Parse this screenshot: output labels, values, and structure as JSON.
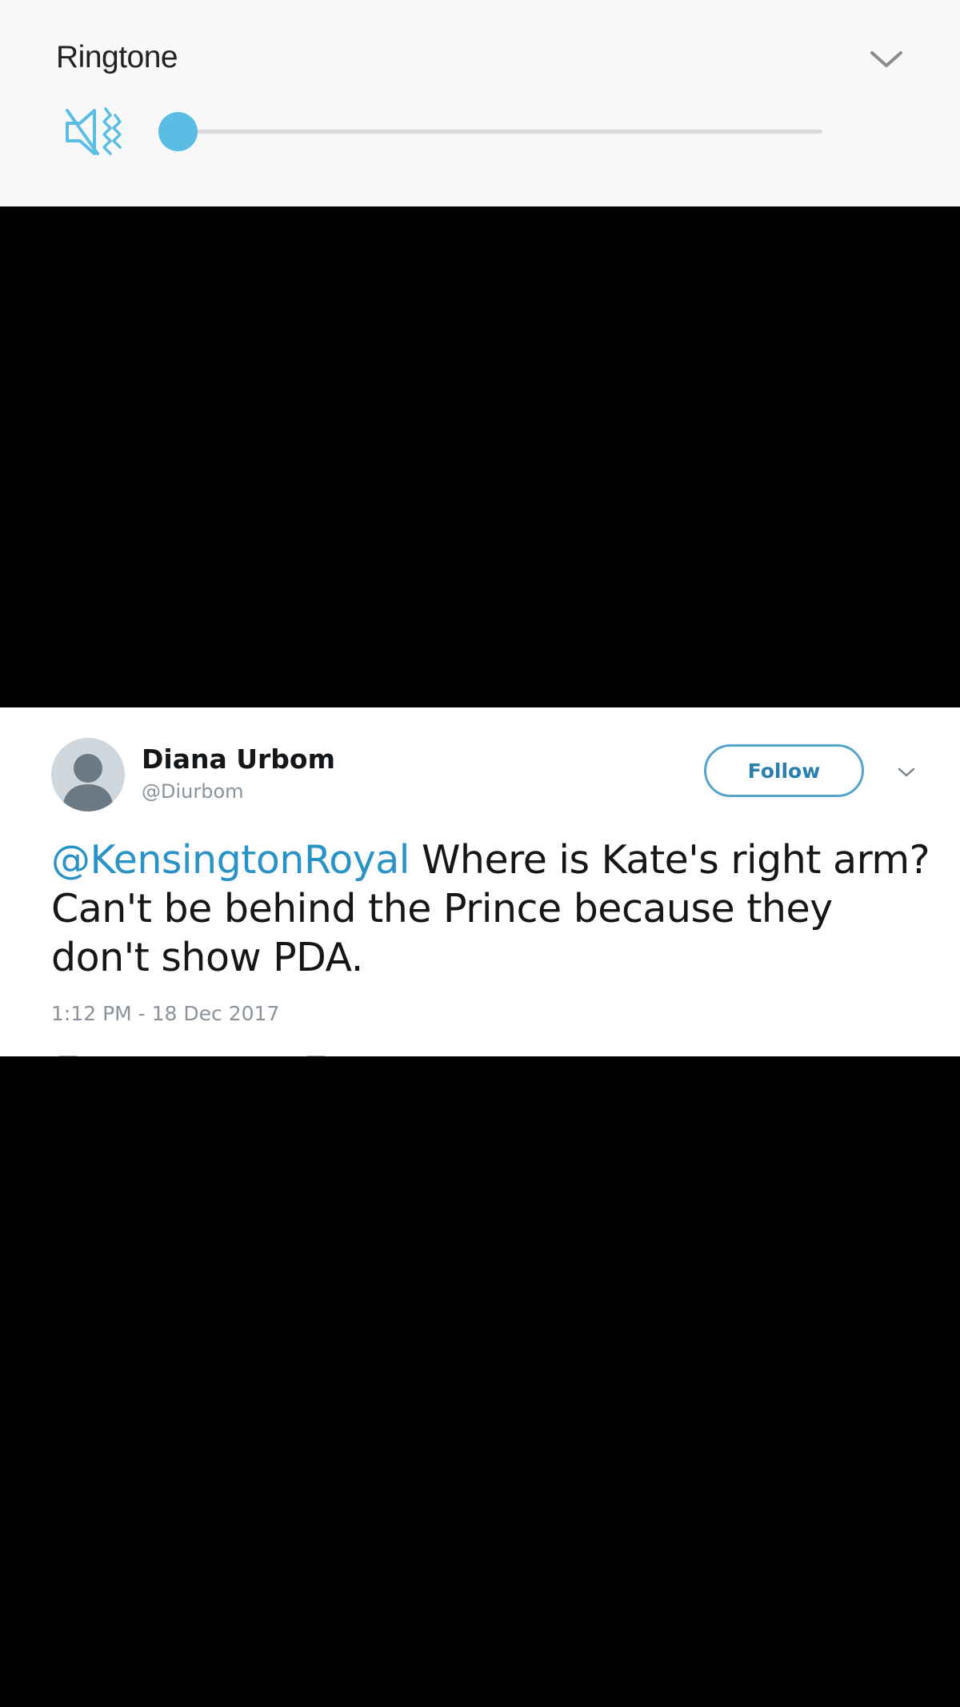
{
  "volume_panel": {
    "title": "Ringtone",
    "expand_icon": "chevron-down-icon",
    "mute_icon": "speaker-vibrate-icon",
    "level": 0,
    "accent_color": "#5bbde4"
  },
  "tweet": {
    "name": "Diana Urbom",
    "handle": "@Diurbom",
    "follow_label": "Follow",
    "mention": "@KensingtonRoyal",
    "body": " Where is Kate's right arm? Can't be behind the Prince because they don't show PDA.",
    "timestamp": "1:12 PM - 18 Dec 2017",
    "mention_color": "#2a93c6"
  }
}
